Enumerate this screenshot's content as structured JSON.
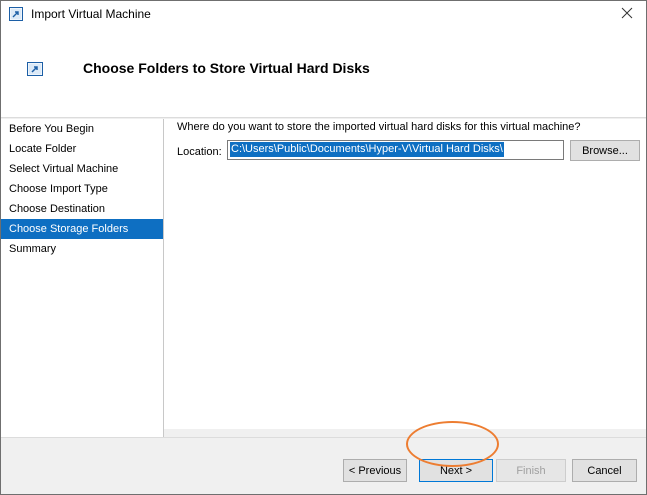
{
  "window": {
    "title": "Import Virtual Machine",
    "close_glyph": "×"
  },
  "header": {
    "title": "Choose Folders to Store Virtual Hard Disks",
    "icon": "import-vm-icon"
  },
  "nav": {
    "items": [
      {
        "label": "Before You Begin",
        "active": false
      },
      {
        "label": "Locate Folder",
        "active": false
      },
      {
        "label": "Select Virtual Machine",
        "active": false
      },
      {
        "label": "Choose Import Type",
        "active": false
      },
      {
        "label": "Choose Destination",
        "active": false
      },
      {
        "label": "Choose Storage Folders",
        "active": true
      },
      {
        "label": "Summary",
        "active": false
      }
    ]
  },
  "main": {
    "question": "Where do you want to store the imported virtual hard disks for this virtual machine?",
    "location_label": "Location:",
    "location_value": "C:\\Users\\Public\\Documents\\Hyper-V\\Virtual Hard Disks\\",
    "browse_label": "Browse..."
  },
  "footer": {
    "previous_label": "< Previous",
    "next_label": "Next >",
    "finish_label": "Finish",
    "cancel_label": "Cancel"
  },
  "colors": {
    "accent": "#0e6fc2",
    "highlight_ring": "#ed7d31"
  }
}
